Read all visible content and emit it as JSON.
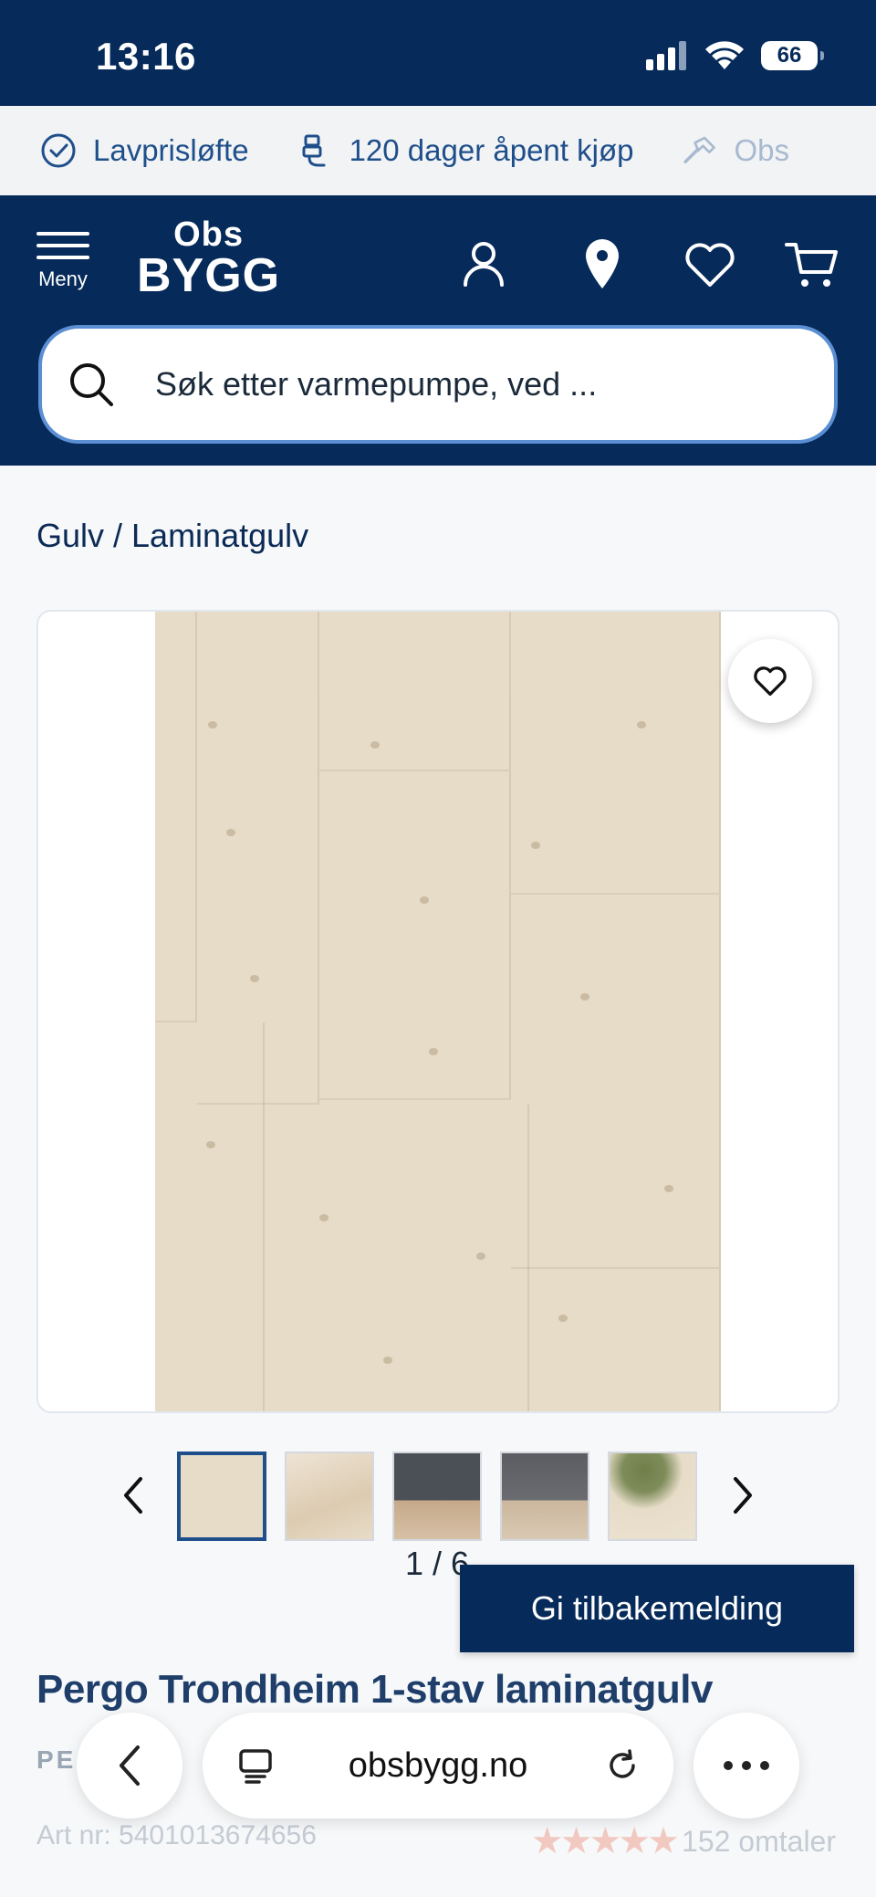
{
  "status_bar": {
    "time": "13:16",
    "battery": "66"
  },
  "usp": [
    {
      "label": "Lavprisløfte",
      "icon": "check-circle-icon"
    },
    {
      "label": "120 dager åpent kjøp",
      "icon": "return-icon"
    },
    {
      "label": "Obs",
      "icon": "hammer-icon"
    }
  ],
  "header": {
    "menu_label": "Meny",
    "logo_top": "Obs",
    "logo_bottom": "BYGG",
    "icons": [
      "user-icon",
      "location-icon",
      "heart-icon",
      "cart-icon"
    ]
  },
  "search": {
    "placeholder": "Søk etter varmepumpe, ved ..."
  },
  "breadcrumb": "Gulv / Laminatgulv",
  "gallery": {
    "counter": "1 / 6",
    "thumbnail_count": 5
  },
  "feedback_button": "Gi tilbakemelding",
  "product": {
    "title": "Pergo Trondheim 1-stav laminatgulv",
    "brand": "PE",
    "art_nr": "Art nr: 5401013674656",
    "rating": 4.5,
    "reviews": "152 omtaler"
  },
  "browser": {
    "url": "obsbygg.no"
  },
  "colors": {
    "brand_navy": "#062a5a",
    "accent_blue": "#1f4f8b",
    "search_border": "#5b8fd4"
  }
}
